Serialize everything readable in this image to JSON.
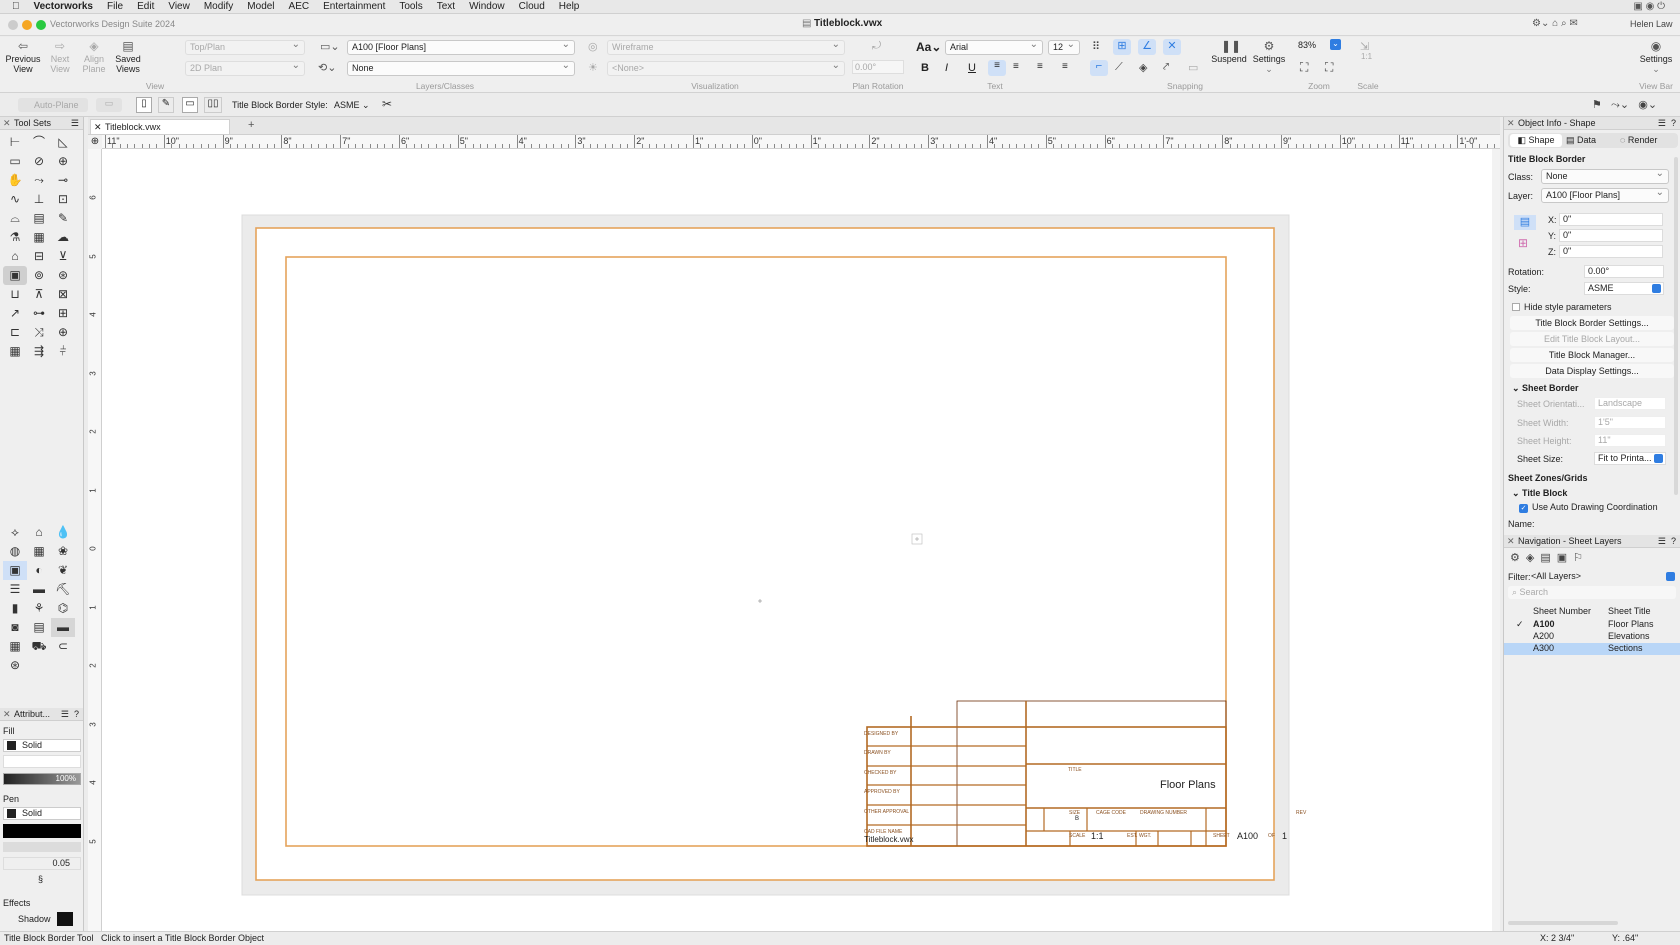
{
  "menubar": {
    "app": "Vectorworks",
    "items": [
      "File",
      "Edit",
      "View",
      "Modify",
      "Model",
      "AEC",
      "Entertainment",
      "Tools",
      "Text",
      "Window",
      "Cloud",
      "Help"
    ]
  },
  "window": {
    "suite": "Vectorworks Design Suite 2024",
    "title": "Titleblock.vwx",
    "user": "Helen Law"
  },
  "toolbar": {
    "view": {
      "previous": [
        "Previous",
        "View"
      ],
      "next": [
        "Next",
        "View"
      ],
      "align": [
        "Align",
        "Plane"
      ],
      "saved": [
        "Saved",
        "Views"
      ],
      "view_select": "Top/Plan",
      "plane_select": "2D Plan",
      "label": "View"
    },
    "layers": {
      "layer_select": "A100 [Floor Plans]",
      "class_select": "None",
      "label": "Layers/Classes"
    },
    "visualization": {
      "render_select": "Wireframe",
      "light_select": "<None>",
      "label": "Visualization"
    },
    "plan_rotation": {
      "value": "0.00°",
      "label": "Plan Rotation"
    },
    "text": {
      "font": "Arial",
      "size": "12",
      "label": "Text",
      "bold": "B",
      "italic": "I",
      "underline": "U"
    },
    "snapping": {
      "label": "Snapping"
    },
    "suspend": "Suspend",
    "settings": "Settings",
    "zoom": {
      "value": "83%",
      "label": "Zoom"
    },
    "scale": {
      "value": "1:1",
      "label": "Scale"
    },
    "viewbar": {
      "settings": "Settings",
      "label": "View Bar"
    }
  },
  "modebar": {
    "auto_plane": "Auto-Plane",
    "style_label": "Title Block Border Style:",
    "style_value": "ASME"
  },
  "tool_sets": {
    "title": "Tool Sets"
  },
  "attributes": {
    "title": "Attribut...",
    "fill_label": "Fill",
    "fill_value": "Solid",
    "opacity": "100%",
    "pen_label": "Pen",
    "pen_value": "Solid",
    "line_weight": "0.05",
    "effects_label": "Effects",
    "shadow_label": "Shadow"
  },
  "document": {
    "tab": "Titleblock.vwx",
    "ruler_h": [
      "11\"",
      "10\"",
      "9\"",
      "8\"",
      "7\"",
      "6\"",
      "5\"",
      "4\"",
      "3\"",
      "2\"",
      "1\"",
      "0\"",
      "1\"",
      "2\"",
      "3\"",
      "4\"",
      "5\"",
      "6\"",
      "7\"",
      "8\"",
      "9\"",
      "10\"",
      "11\"",
      "1'-0\""
    ],
    "ruler_v": [
      "6",
      "5",
      "4",
      "3",
      "2",
      "1",
      "0",
      "1",
      "2",
      "3",
      "4",
      "5"
    ]
  },
  "titleblock": {
    "cells_left": [
      "DESIGNED BY",
      "DRAWN BY",
      "CHECKED BY",
      "APPROVED BY",
      "OTHER APPROVAL",
      "CAD FILE NAME"
    ],
    "file_name": "Titleblock.vwx",
    "title_label": "TITLE",
    "title": "Floor Plans",
    "size_label": "SIZE",
    "cage_label": "CAGE CODE",
    "dwg_label": "DRAWING NUMBER",
    "rev_label": "REV",
    "size_value": "B",
    "scale_label": "SCALE",
    "scale_value": "1:1",
    "wt_label": "EST. WGT.",
    "sheet_label": "SHEET",
    "sheet_number": "A100",
    "of_label": "OF",
    "sheet_count": "1"
  },
  "object_info": {
    "title": "Object Info - Shape",
    "tabs": [
      "Shape",
      "Data",
      "Render"
    ],
    "object_type": "Title Block Border",
    "class_label": "Class:",
    "class_value": "None",
    "layer_label": "Layer:",
    "layer_value": "A100 [Floor Plans]",
    "x_label": "X:",
    "x_value": "0\"",
    "y_label": "Y:",
    "y_value": "0\"",
    "z_label": "Z:",
    "z_value": "0\"",
    "rotation_label": "Rotation:",
    "rotation_value": "0.00°",
    "style_label": "Style:",
    "style_value": "ASME",
    "hide_style": "Hide style parameters",
    "buttons": [
      "Title Block Border Settings...",
      "Edit Title Block Layout...",
      "Title Block Manager...",
      "Data Display Settings..."
    ],
    "sheet_border": "Sheet Border",
    "orientation_label": "Sheet Orientati...",
    "orientation_value": "Landscape",
    "width_label": "Sheet Width:",
    "width_value": "1'5\"",
    "height_label": "Sheet Height:",
    "height_value": "11\"",
    "size_label": "Sheet Size:",
    "size_value": "Fit to Printa...",
    "zones": "Sheet Zones/Grids",
    "title_block": "Title Block",
    "auto_coord": "Use Auto Drawing Coordination",
    "name_label": "Name:"
  },
  "navigation": {
    "title": "Navigation - Sheet Layers",
    "filter_label": "Filter:",
    "filter_value": "<All Layers>",
    "search_placeholder": "Search",
    "col_number": "Sheet Number",
    "col_title": "Sheet Title",
    "rows": [
      {
        "number": "A100",
        "title": "Floor Plans",
        "active": true
      },
      {
        "number": "A200",
        "title": "Elevations",
        "active": false
      },
      {
        "number": "A300",
        "title": "Sections",
        "active": false
      }
    ]
  },
  "status": {
    "tool": "Title Block Border Tool",
    "hint": "Click to insert a Title Block Border Object",
    "x": "X: 2 3/4\"",
    "y": "Y: .64\""
  },
  "colors": {
    "accent": "#2f7de1",
    "border": "#e4a35c",
    "selected_row": "#b9d6f7"
  }
}
